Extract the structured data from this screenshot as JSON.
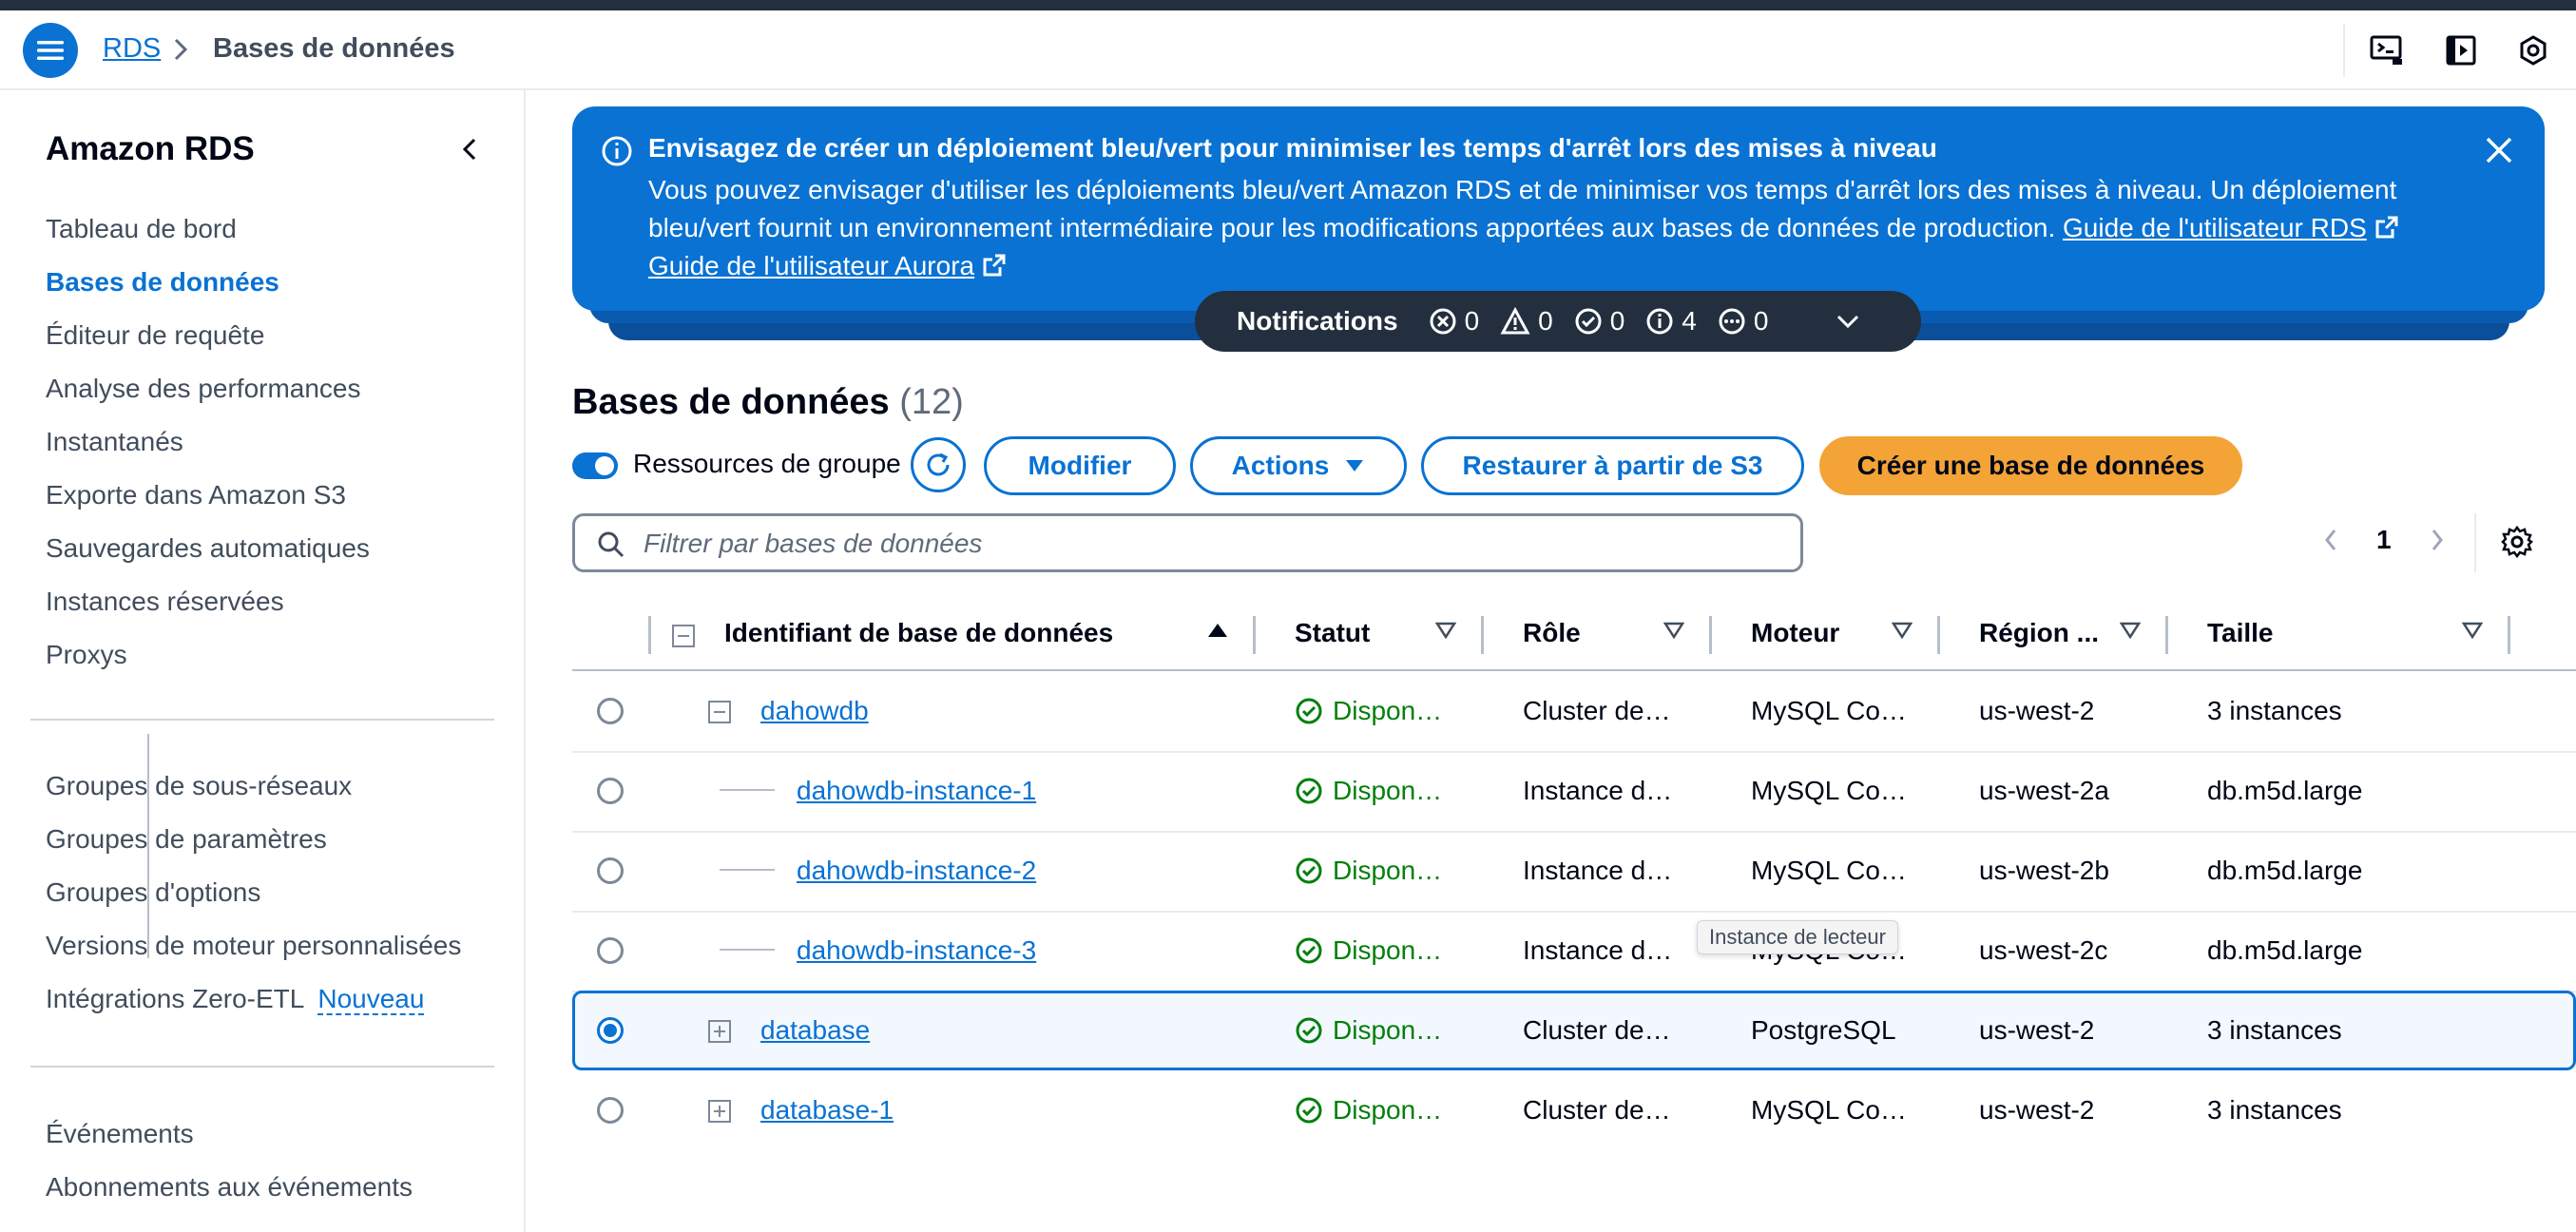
{
  "breadcrumb": {
    "root": "RDS",
    "current": "Bases de données"
  },
  "sidebar": {
    "title": "Amazon RDS",
    "group1": [
      "Tableau de bord",
      "Bases de données",
      "Éditeur de requête",
      "Analyse des performances",
      "Instantanés",
      "Exporte dans Amazon S3",
      "Sauvegardes automatiques",
      "Instances réservées",
      "Proxys"
    ],
    "group2": [
      "Groupes de sous-réseaux",
      "Groupes de paramètres",
      "Groupes d'options",
      "Versions de moteur personnalisées",
      "Intégrations Zero-ETL"
    ],
    "new_badge": "Nouveau",
    "group3": [
      "Événements",
      "Abonnements aux événements"
    ]
  },
  "flash": {
    "title": "Envisagez de créer un déploiement bleu/vert pour minimiser les temps d'arrêt lors des mises à niveau",
    "body": "Vous pouvez envisager d'utiliser les déploiements bleu/vert Amazon RDS et de minimiser vos temps d'arrêt lors des mises à niveau. Un déploiement bleu/vert fournit un environnement intermédiaire pour les modifications apportées aux bases de données de production.",
    "link1": "Guide de l'utilisateur RDS",
    "link2": "Guide de l'utilisateur Aurora"
  },
  "notifications": {
    "label": "Notifications",
    "errors": "0",
    "warnings": "0",
    "success": "0",
    "info": "4",
    "in_progress": "0"
  },
  "page": {
    "title": "Bases de données",
    "count": "(12)"
  },
  "toolbar": {
    "group_toggle_label": "Ressources de groupe",
    "modify": "Modifier",
    "actions": "Actions",
    "restore_s3": "Restaurer à partir de S3",
    "create": "Créer une base de données"
  },
  "search": {
    "placeholder": "Filtrer par bases de données"
  },
  "pagination": {
    "current": "1"
  },
  "table": {
    "columns": [
      "Identifiant de base de données",
      "Statut",
      "Rôle",
      "Moteur",
      "Région ...",
      "Taille"
    ],
    "rows": [
      {
        "id": "dahowdb",
        "status": "Dispon…",
        "role": "Cluster de…",
        "engine": "MySQL Co…",
        "region": "us-west-2",
        "size": "3 instances"
      },
      {
        "id": "dahowdb-instance-1",
        "status": "Dispon…",
        "role": "Instance d…",
        "engine": "MySQL Co…",
        "region": "us-west-2a",
        "size": "db.m5d.large"
      },
      {
        "id": "dahowdb-instance-2",
        "status": "Dispon…",
        "role": "Instance d…",
        "engine": "MySQL Co…",
        "region": "us-west-2b",
        "size": "db.m5d.large"
      },
      {
        "id": "dahowdb-instance-3",
        "status": "Dispon…",
        "role": "Instance d…",
        "engine": "MySQL Co…",
        "region": "us-west-2c",
        "size": "db.m5d.large"
      },
      {
        "id": "database",
        "status": "Dispon…",
        "role": "Cluster de…",
        "engine": "PostgreSQL",
        "region": "us-west-2",
        "size": "3 instances"
      },
      {
        "id": "database-1",
        "status": "Dispon…",
        "role": "Cluster de…",
        "engine": "MySQL Co…",
        "region": "us-west-2",
        "size": "3 instances"
      }
    ]
  },
  "tooltip": "Instance de lecteur",
  "colors": {
    "accent": "#0972d3",
    "primary_button": "#f4a337",
    "success": "#037f0c",
    "notification_bar": "#232f3e"
  }
}
